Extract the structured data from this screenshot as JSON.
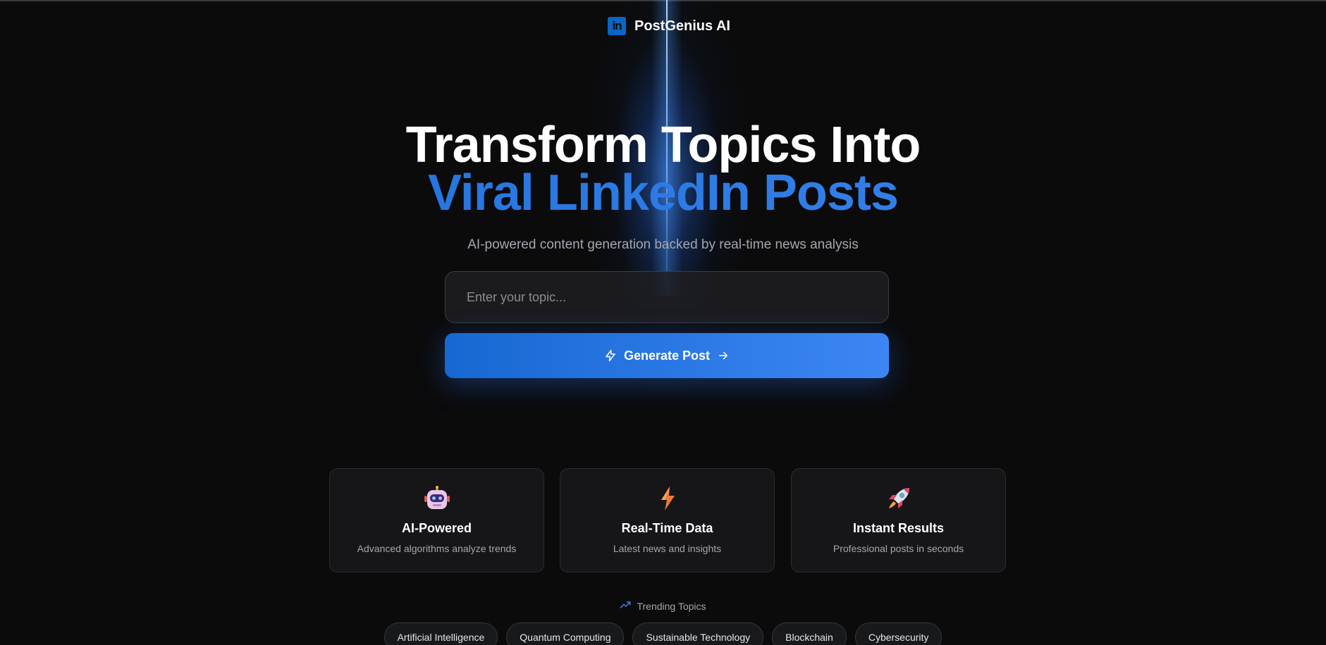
{
  "brand": {
    "logo_text": "in",
    "name": "PostGenius AI",
    "logo_color": "#0a66c2"
  },
  "hero": {
    "title_line1": "Transform Topics Into",
    "title_line2": "Viral LinkedIn Posts",
    "subtitle": "AI-powered content generation backed by real-time news analysis",
    "accent_color": "#2f7ae5"
  },
  "form": {
    "topic_placeholder": "Enter your topic...",
    "topic_value": "",
    "generate_label": "Generate Post",
    "generate_icon": "lightning-icon",
    "generate_trailing_icon": "arrow-right-icon"
  },
  "features": [
    {
      "icon": "robot-icon",
      "title": "AI-Powered",
      "description": "Advanced algorithms analyze trends"
    },
    {
      "icon": "lightning-bolt-icon",
      "title": "Real-Time Data",
      "description": "Latest news and insights"
    },
    {
      "icon": "rocket-icon",
      "title": "Instant Results",
      "description": "Professional posts in seconds"
    }
  ],
  "trending": {
    "icon": "trending-up-icon",
    "label": "Trending Topics",
    "topics": [
      "Artificial Intelligence",
      "Quantum Computing",
      "Sustainable Technology",
      "Blockchain",
      "Cybersecurity"
    ]
  }
}
